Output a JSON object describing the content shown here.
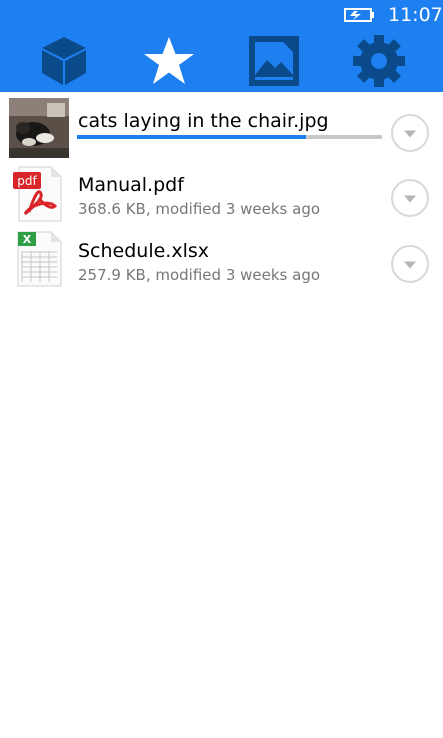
{
  "status_bar": {
    "time": "11:07",
    "battery_icon": "battery-charging-icon"
  },
  "tabs": [
    {
      "name": "files",
      "icon": "cube-icon"
    },
    {
      "name": "favorites",
      "icon": "star-icon"
    },
    {
      "name": "photos",
      "icon": "picture-icon"
    },
    {
      "name": "settings",
      "icon": "gear-icon"
    }
  ],
  "files": [
    {
      "name": "cats laying in the chair.jpg",
      "meta": "",
      "progress": 0.75,
      "icon": "photo-thumbnail"
    },
    {
      "name": "Manual.pdf",
      "meta": "368.6 KB, modified 3 weeks ago",
      "icon": "pdf-icon",
      "icon_label": "pdf"
    },
    {
      "name": "Schedule.xlsx",
      "meta": "257.9 KB, modified 3 weeks ago",
      "icon": "excel-icon",
      "icon_label": "X"
    }
  ],
  "colors": {
    "accent": "#1e7ff0",
    "icon_dark": "#0b4a8a",
    "pdf_red": "#d9252a",
    "excel_green": "#2f9e44"
  }
}
